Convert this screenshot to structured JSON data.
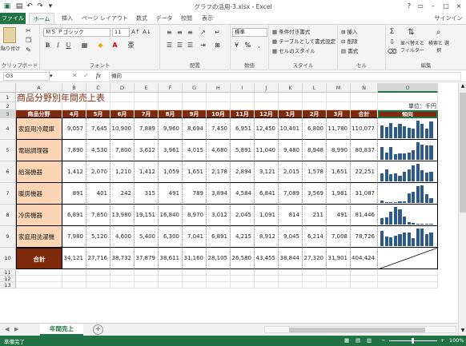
{
  "window": {
    "title": "グラフの活用-3.xlsx - Excel",
    "signin": "サインイン"
  },
  "tabs": [
    "ファイル",
    "ホーム",
    "挿入",
    "ページ レイアウト",
    "数式",
    "データ",
    "校閲",
    "表示"
  ],
  "ribbon": {
    "clipboard": {
      "paste": "貼り付け",
      "label": "クリップボード"
    },
    "font": {
      "name": "ＭＳ Ｐゴシック",
      "size": "11",
      "label": "フォント",
      "bold": "B",
      "italic": "I",
      "underline": "U"
    },
    "alignment": {
      "label": "配置"
    },
    "number": {
      "format": "標準",
      "label": "数値",
      "percent": "%"
    },
    "styles": {
      "cond": "条件付き書式",
      "table": "テーブルとして書式設定",
      "cell": "セルのスタイル",
      "label": "スタイル"
    },
    "cells": {
      "insert": "挿入",
      "delete": "削除",
      "format": "書式",
      "label": "セル"
    },
    "editing": {
      "sort": "並べ替えと フィルター",
      "find": "検索と 選択",
      "label": "編集"
    }
  },
  "formula_bar": {
    "name_box": "O3",
    "fx": "fx",
    "content": "傾向"
  },
  "columns": [
    "A",
    "B",
    "C",
    "D",
    "E",
    "F",
    "G",
    "H",
    "I",
    "J",
    "K",
    "L",
    "M",
    "N",
    "O"
  ],
  "rows": [
    "1",
    "2",
    "3",
    "4",
    "5",
    "6",
    "7",
    "8",
    "9",
    "10",
    "11",
    "12",
    "13"
  ],
  "sheet": {
    "title": "商品分野別年間売上表",
    "unit": "単位：千円",
    "headers": [
      "商品分野",
      "4月",
      "5月",
      "6月",
      "7月",
      "8月",
      "9月",
      "10月",
      "11月",
      "12月",
      "1月",
      "2月",
      "3月",
      "合計",
      "傾向"
    ],
    "data": [
      {
        "name": "家庭用冷蔵庫",
        "values": [
          "9,057",
          "7,645",
          "10,900",
          "7,889",
          "9,960",
          "8,694",
          "7,450",
          "6,951",
          "12,450",
          "10,401",
          "6,800",
          "11,780"
        ],
        "total": "110,077"
      },
      {
        "name": "電磁調理器",
        "values": [
          "7,890",
          "4,530",
          "7,800",
          "3,612",
          "3,961",
          "4,015",
          "4,680",
          "5,891",
          "11,040",
          "9,480",
          "8,948",
          "8,990"
        ],
        "total": "80,837"
      },
      {
        "name": "給湯機器",
        "values": [
          "1,412",
          "2,070",
          "1,210",
          "1,412",
          "1,059",
          "1,651",
          "2,178",
          "2,894",
          "3,121",
          "2,015",
          "1,578",
          "1,651"
        ],
        "total": "22,251"
      },
      {
        "name": "暖房機器",
        "values": [
          "891",
          "401",
          "242",
          "315",
          "491",
          "789",
          "3,894",
          "4,584",
          "6,841",
          "7,089",
          "3,569",
          "1,981"
        ],
        "total": "31,087"
      },
      {
        "name": "冷房機器",
        "values": [
          "6,891",
          "7,850",
          "13,980",
          "19,151",
          "16,840",
          "8,970",
          "3,012",
          "2,045",
          "1,091",
          "814",
          "211",
          "491"
        ],
        "total": "81,446"
      },
      {
        "name": "家庭用洗濯機",
        "values": [
          "7,980",
          "5,120",
          "4,600",
          "5,400",
          "6,300",
          "7,041",
          "6,891",
          "4,215",
          "8,912",
          "9,045",
          "6,214",
          "7,008"
        ],
        "total": "78,726"
      }
    ],
    "sum_label": "合計",
    "sums": [
      "34,121",
      "27,716",
      "38,732",
      "37,879",
      "38,611",
      "31,160",
      "28,105",
      "26,580",
      "43,455",
      "38,844",
      "27,320",
      "31,901"
    ],
    "sum_total": "404,424",
    "spark_values": [
      [
        9057,
        7645,
        10900,
        7889,
        9960,
        8694,
        7450,
        6951,
        12450,
        10401,
        6800,
        11780
      ],
      [
        7890,
        4530,
        7800,
        3612,
        3961,
        4015,
        4680,
        5891,
        11040,
        9480,
        8948,
        8990
      ],
      [
        1412,
        2070,
        1210,
        1412,
        1059,
        1651,
        2178,
        2894,
        3121,
        2015,
        1578,
        1651
      ],
      [
        891,
        401,
        242,
        315,
        491,
        789,
        3894,
        4584,
        6841,
        7089,
        3569,
        1981
      ],
      [
        6891,
        7850,
        13980,
        19151,
        16840,
        8970,
        3012,
        2045,
        1091,
        814,
        211,
        491
      ],
      [
        7980,
        5120,
        4600,
        5400,
        6300,
        7041,
        6891,
        4215,
        8912,
        9045,
        6214,
        7008
      ]
    ]
  },
  "sheet_tab": "年間売上",
  "status": {
    "ready": "準備完了",
    "zoom": "100%"
  },
  "colors": {
    "accent": "#217346",
    "header": "#7f2a0c",
    "category": "#fbd4b4",
    "spark": "#2e5a8a"
  }
}
